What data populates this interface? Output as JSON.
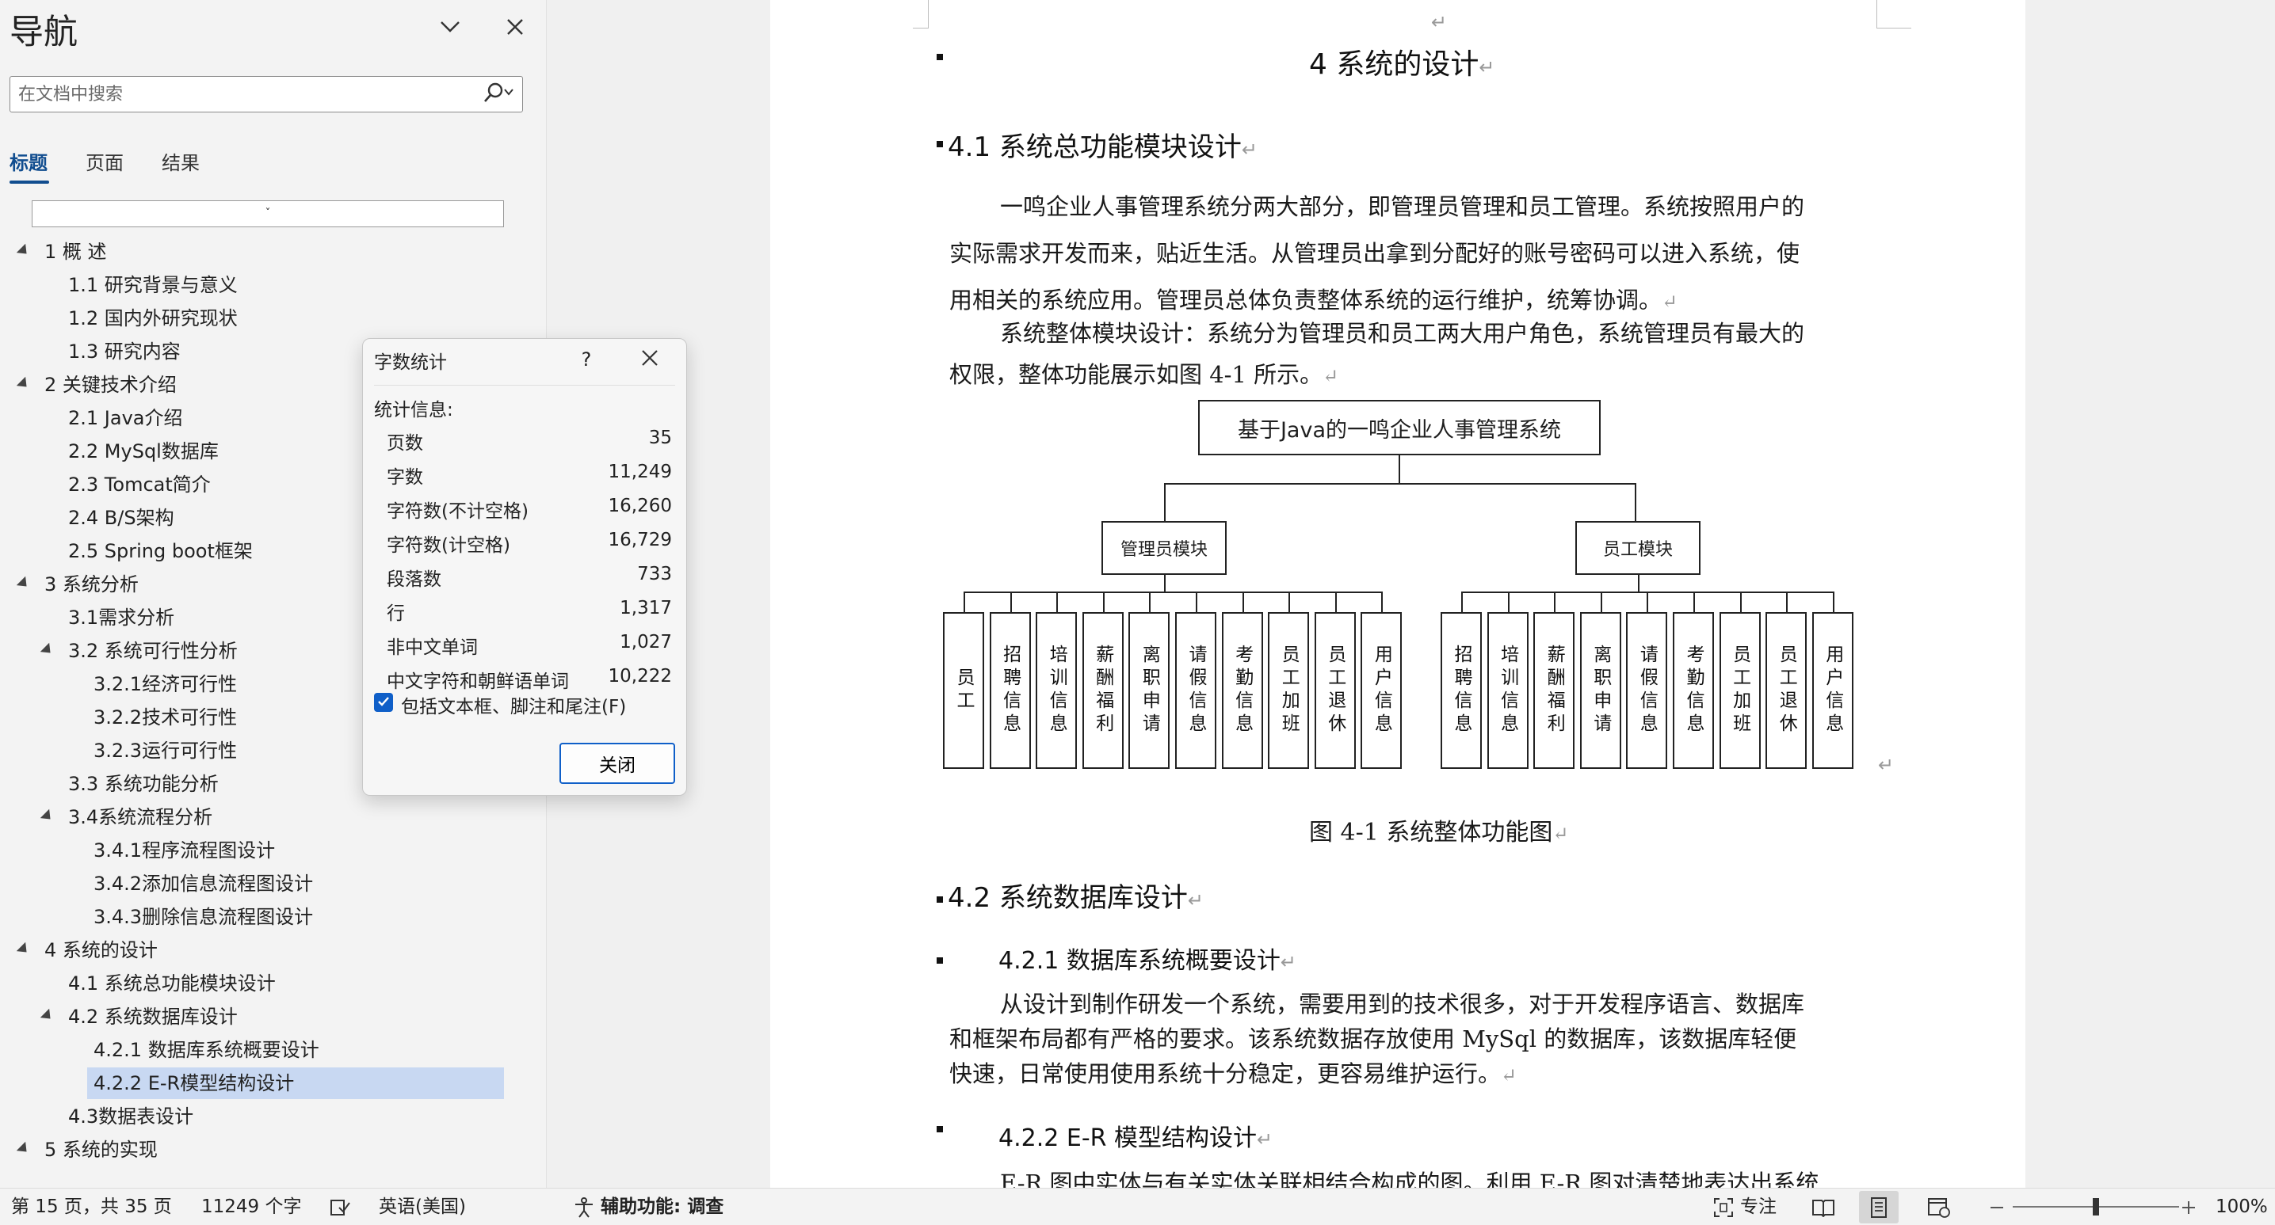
{
  "nav": {
    "title": "导航",
    "search_placeholder": "在文档中搜索",
    "tabs": [
      "标题",
      "页面",
      "结果"
    ],
    "collapse_label": "ˇ",
    "tree": [
      {
        "label": "1  概    述",
        "level": 1,
        "expanded": true
      },
      {
        "label": "1.1 研究背景与意义",
        "level": 2
      },
      {
        "label": "1.2 国内外研究现状",
        "level": 2
      },
      {
        "label": "1.3 研究内容",
        "level": 2
      },
      {
        "label": "2  关键技术介绍",
        "level": 1,
        "expanded": true
      },
      {
        "label": "2.1 Java介绍",
        "level": 2
      },
      {
        "label": "2.2 MySql数据库",
        "level": 2
      },
      {
        "label": "2.3 Tomcat简介",
        "level": 2
      },
      {
        "label": "2.4 B/S架构",
        "level": 2
      },
      {
        "label": "2.5 Spring boot框架",
        "level": 2
      },
      {
        "label": "3  系统分析",
        "level": 1,
        "expanded": true
      },
      {
        "label": "3.1需求分析",
        "level": 2
      },
      {
        "label": "3.2 系统可行性分析",
        "level": 2,
        "expanded": true
      },
      {
        "label": "3.2.1经济可行性",
        "level": 3
      },
      {
        "label": "3.2.2技术可行性",
        "level": 3
      },
      {
        "label": "3.2.3运行可行性",
        "level": 3
      },
      {
        "label": "3.3 系统功能分析",
        "level": 2
      },
      {
        "label": "3.4系统流程分析",
        "level": 2,
        "expanded": true
      },
      {
        "label": "3.4.1程序流程图设计",
        "level": 3
      },
      {
        "label": "3.4.2添加信息流程图设计",
        "level": 3
      },
      {
        "label": "3.4.3删除信息流程图设计",
        "level": 3
      },
      {
        "label": "4  系统的设计",
        "level": 1,
        "expanded": true
      },
      {
        "label": "4.1 系统总功能模块设计",
        "level": 2
      },
      {
        "label": "4.2 系统数据库设计",
        "level": 2,
        "expanded": true
      },
      {
        "label": "4.2.1 数据库系统概要设计",
        "level": 3
      },
      {
        "label": "4.2.2 E-R模型结构设计",
        "level": 3,
        "selected": true
      },
      {
        "label": "4.3数据表设计",
        "level": 2
      },
      {
        "label": "5  系统的实现",
        "level": 1,
        "expanded": true
      }
    ]
  },
  "document": {
    "heading_4": "4    系统的设计",
    "heading_4_1": "4.1  系统总功能模块设计",
    "para1": [
      "一鸣企业人事管理系统分两大部分，即管理员管理和员工管理。系统按照用户的",
      "实际需求开发而来，贴近生活。从管理员出拿到分配好的账号密码可以进入系统，使",
      "用相关的系统应用。管理员总体负责整体系统的运行维护，统筹协调。"
    ],
    "para2": [
      "系统整体模块设计：系统分为管理员和员工两大用户角色，系统管理员有最大的",
      "权限，整体功能展示如图 4-1 所示。"
    ],
    "figure_caption": "图 4-1  系统整体功能图",
    "heading_4_2": "4.2  系统数据库设计",
    "heading_4_2_1": "4.2.1  数据库系统概要设计",
    "para3": [
      "从设计到制作研发一个系统，需要用到的技术很多，对于开发程序语言、数据库",
      "和框架布局都有严格的要求。该系统数据存放使用 MySql 的数据库，该数据库轻便",
      "快速，日常使用使用系统十分稳定，更容易维护运行。"
    ],
    "heading_4_2_2": "4.2.2  E-R 模型结构设计",
    "para4_partial": "E-R 图中实体与有关实体关联相结合构成的图。利用 E-R 图对清楚地表达出系统",
    "para_mark": "↵"
  },
  "org_chart": {
    "root": "基于Java的一鸣企业人事管理系统",
    "admin": {
      "label": "管理员模块",
      "children": [
        "员工",
        "招聘信息",
        "培训信息",
        "薪酬福利",
        "离职申请",
        "请假信息",
        "考勤信息",
        "员工加班",
        "员工退休",
        "用户信息"
      ]
    },
    "staff": {
      "label": "员工模块",
      "children": [
        "招聘信息",
        "培训信息",
        "薪酬福利",
        "离职申请",
        "请假信息",
        "考勤信息",
        "员工加班",
        "员工退休",
        "用户信息"
      ]
    }
  },
  "dialog": {
    "title": "字数统计",
    "help": "?",
    "stats_header": "统计信息:",
    "stats": [
      {
        "label": "页数",
        "value": "35"
      },
      {
        "label": "字数",
        "value": "11,249"
      },
      {
        "label": "字符数(不计空格)",
        "value": "16,260"
      },
      {
        "label": "字符数(计空格)",
        "value": "16,729"
      },
      {
        "label": "段落数",
        "value": "733"
      },
      {
        "label": "行",
        "value": "1,317"
      },
      {
        "label": "非中文单词",
        "value": "1,027"
      },
      {
        "label": "中文字符和朝鲜语单词",
        "value": "10,222"
      }
    ],
    "include_label": "包括文本框、脚注和尾注(F)",
    "include_checked": true,
    "close_label": "关闭"
  },
  "status": {
    "page": "第 15 页，共 35 页",
    "words": "11249 个字",
    "language": "英语(美国)",
    "accessibility": "辅助功能: 调查",
    "focus": "专注",
    "zoom": "100%",
    "zoom_fraction": 0.5
  },
  "colors": {
    "accent": "#114d8f",
    "selected": "#c8d8f2",
    "checkbox": "#0f5fc8"
  }
}
